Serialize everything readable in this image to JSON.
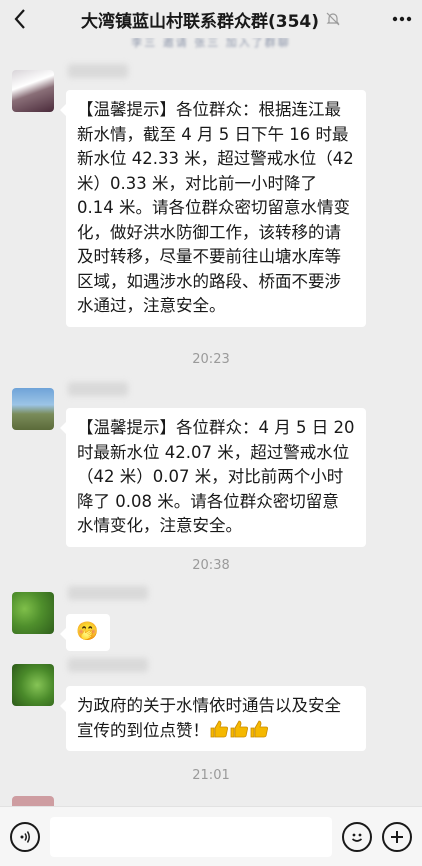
{
  "header": {
    "title": "大湾镇蓝山村联系群众群(354)",
    "notice": "李三 邀请 张三 加入了群聊"
  },
  "messages": [
    {
      "text": "【温馨提示】各位群众：根据连江最新水情，截至 4 月 5 日下午 16 时最新水位 42.33 米，超过警戒水位（42 米）0.33 米，对比前一小时降了 0.14 米。请各位群众密切留意水情变化，做好洪水防御工作，该转移的请及时转移，尽量不要前往山塘水库等区域，如遇涉水的路段、桥面不要涉水通过，注意安全。"
    },
    {
      "text": "【温馨提示】各位群众：4 月 5 日 20 时最新水位 42.07 米，超过警戒水位（42 米）0.07 米，对比前两个小时降了 0.08 米。请各位群众密切留意水情变化，注意安全。"
    },
    {
      "emoji": "🤭"
    },
    {
      "text": "为政府的关于水情依时通告以及安全宣传的到位点赞！"
    }
  ],
  "timestamps": [
    "20:23",
    "20:38",
    "21:01"
  ],
  "icons": {
    "back": "chevron-left-icon",
    "mute": "bell-off-icon",
    "more": "ellipsis-icon",
    "voice": "voice-icon",
    "emoji": "emoji-icon",
    "plus": "plus-icon",
    "thumbs": "thumbs-up-icon"
  },
  "colors": {
    "background": "#ededed",
    "bubble": "#ffffff",
    "thumb": "#f5b800"
  }
}
